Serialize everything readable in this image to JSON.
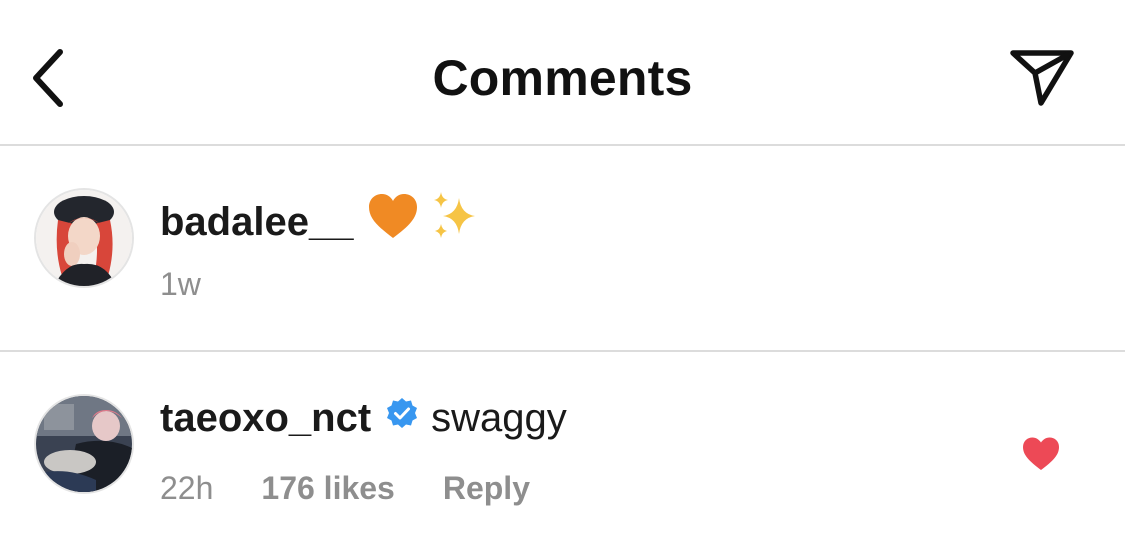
{
  "header": {
    "title": "Comments",
    "back_icon": "chevron-left-icon",
    "share_icon": "paper-plane-icon"
  },
  "comments": [
    {
      "username": "badalee__",
      "text": "",
      "emojis": [
        "orange-heart-emoji",
        "sparkles-emoji"
      ],
      "time": "1w",
      "verified": false
    },
    {
      "username": "taeoxo_nct",
      "text": "swaggy",
      "verified": true,
      "time": "22h",
      "likes": "176 likes",
      "reply": "Reply",
      "liked": true
    }
  ],
  "colors": {
    "text": "#1a1a1a",
    "secondary": "#8e8e8e",
    "divider": "#dcdcdc",
    "liked_heart": "#ed4956",
    "verified_badge": "#3897f0",
    "orange_heart": "#f08a24",
    "sparkles": "#f6c445"
  }
}
